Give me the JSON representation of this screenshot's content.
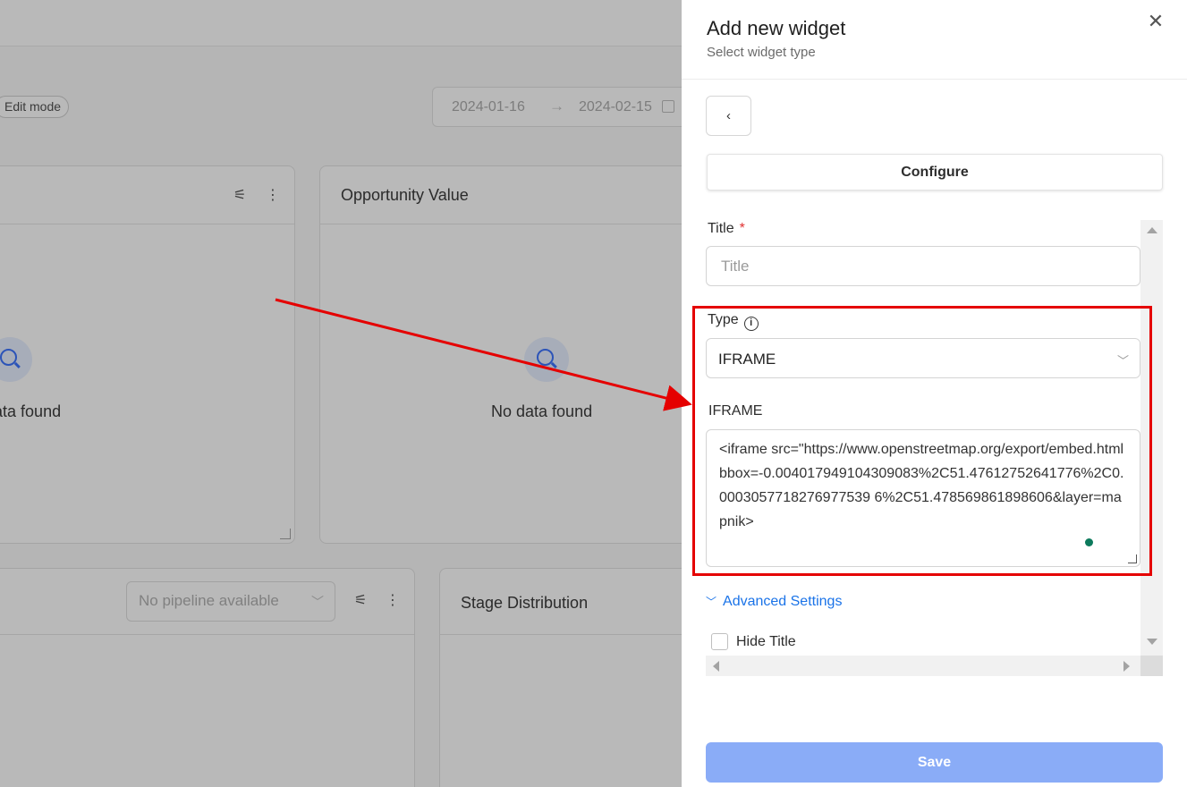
{
  "background": {
    "edit_mode_label": "Edit mode",
    "date_start": "2024-01-16",
    "date_arrow": "→",
    "date_end": "2024-02-15",
    "cards": [
      {
        "title": "",
        "empty_text": "No data found"
      },
      {
        "title": "Opportunity Value",
        "empty_text": "No data found"
      },
      {
        "title": "",
        "pipeline_placeholder": "No pipeline available"
      },
      {
        "title": "Stage Distribution"
      }
    ],
    "filter_icon": "⚟",
    "more_icon": "⋮"
  },
  "drawer": {
    "title": "Add new widget",
    "subtitle": "Select widget type",
    "close_icon": "✕",
    "back_icon": "‹",
    "tab_configure": "Configure",
    "form": {
      "title_label": "Title",
      "title_required": "*",
      "title_placeholder": "Title",
      "type_label": "Type",
      "type_info_icon": "i",
      "type_value": "IFRAME",
      "iframe_label": "IFRAME",
      "iframe_value": "<iframe src=\"https://www.openstreetmap.org/export/embed.htmlbbox=-0.004017949104309083%2C51.47612752641776%2C0.0003057718276977539 6%2C51.478569861898606&layer=mapnik>",
      "advanced_settings": "Advanced Settings",
      "hide_title_label": "Hide Title",
      "hide_title_checked": false
    },
    "save_label": "Save"
  },
  "colors": {
    "accent": "#1a73e8",
    "save_disabled": "#8aacf7",
    "annotation_red": "#e50000"
  }
}
